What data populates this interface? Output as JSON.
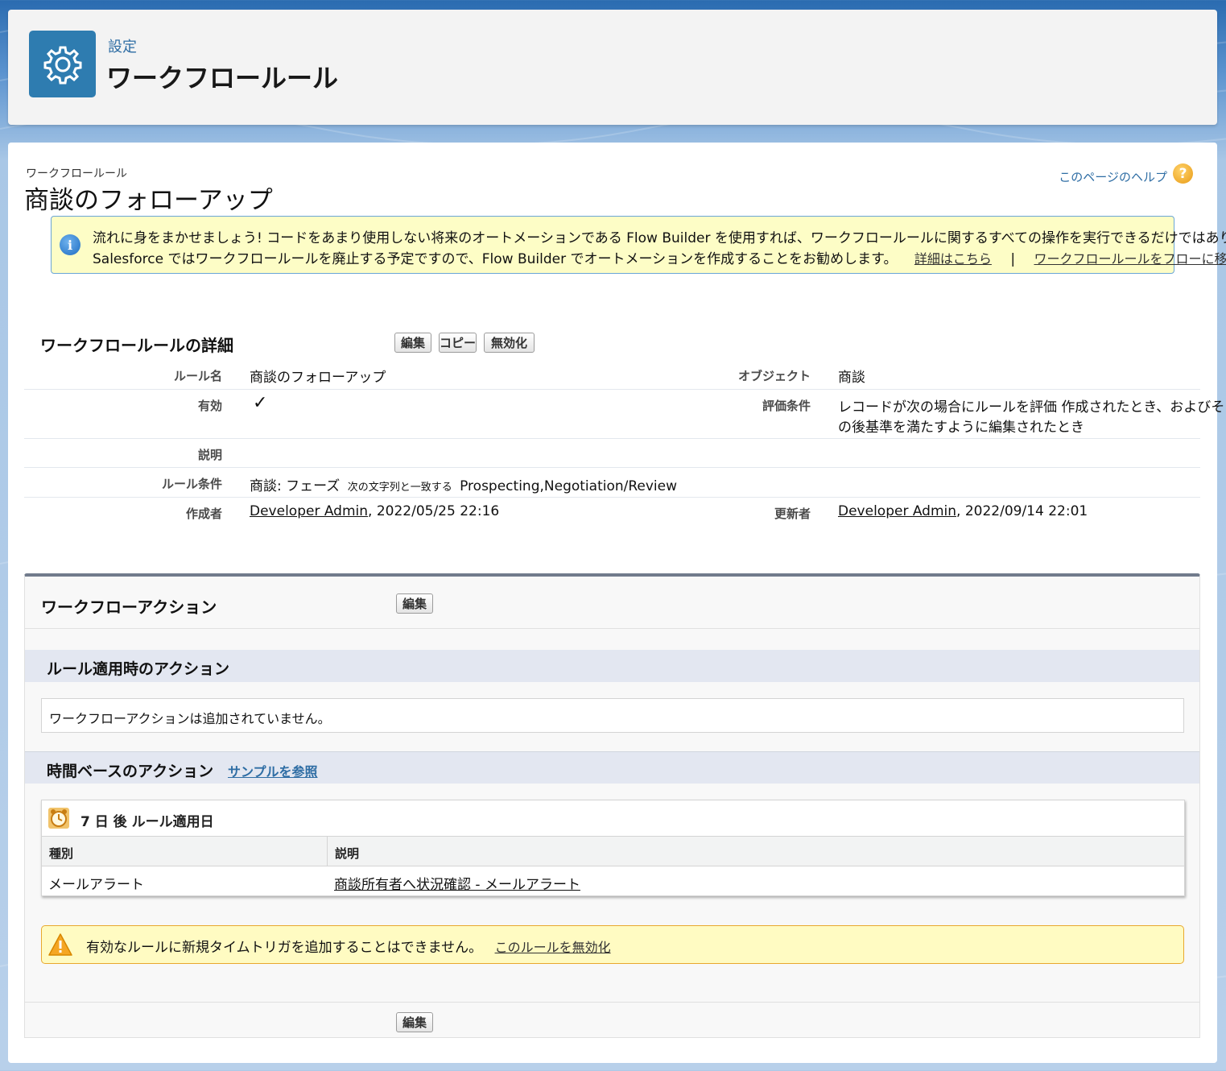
{
  "header": {
    "subtitle": "設定",
    "title": "ワークフロールール",
    "icon": "gear-icon"
  },
  "page": {
    "breadcrumb": "ワークフロールール",
    "title": "商談のフォローアップ",
    "help_link": "このページのヘルプ",
    "help_icon_glyph": "?"
  },
  "info_banner": {
    "icon_glyph": "i",
    "line1": "流れに身をまかせましょう! コードをあまり使用しない将来のオートメーションである Flow Builder を使用すれば、ワークフロールールに関するすべての操作を実行できるだけではありません!",
    "line2": "Salesforce ではワークフロールールを廃止する予定ですので、Flow Builder でオートメーションを作成することをお勧めします。",
    "link_details": "詳細はこちら",
    "separator": "|",
    "link_migrate": "ワークフロールールをフローに移行"
  },
  "detail": {
    "section_title": "ワークフロールールの詳細",
    "buttons": {
      "edit": "編集",
      "copy": "コピー",
      "deactivate": "無効化"
    },
    "rule_name_label": "ルール名",
    "rule_name": "商談のフォローアップ",
    "object_label": "オブジェクト",
    "object": "商談",
    "active_label": "有効",
    "active_check": "✓",
    "eval_label": "評価条件",
    "eval_line1": "レコードが次の場合にルールを評価 作成されたとき、およびそ",
    "eval_line2": "の後基準を満たすように編集されたとき",
    "description_label": "説明",
    "criteria_label": "ルール条件",
    "criteria_field": "商談: フェーズ",
    "criteria_op": "次の文字列と一致する",
    "criteria_value": "Prospecting,Negotiation/Review",
    "created_label": "作成者",
    "created_by": "Developer Admin",
    "created_at": ", 2022/05/25 22:16",
    "modified_label": "更新者",
    "modified_by": "Developer Admin",
    "modified_at": ", 2022/09/14 22:01"
  },
  "actions": {
    "section_title": "ワークフローアクション",
    "edit_button": "編集",
    "immediate_title": "ルール適用時のアクション",
    "immediate_empty": "ワークフローアクションは追加されていません。",
    "time_title": "時間ベースのアクション",
    "time_sample_link": "サンプルを参照",
    "trigger_title": "7 日 後 ルール適用日",
    "trigger_icon": "alarm-clock-icon",
    "table_headers": [
      "種別",
      "説明"
    ],
    "table_rows": [
      {
        "type": "メールアラート",
        "description": "商談所有者へ状況確認 - メールアラート"
      }
    ],
    "warning_text": "有効なルールに新規タイムトリガを追加することはできません。",
    "warning_link": "このルールを無効化",
    "warning_icon": "warning-icon",
    "bottom_edit_button": "編集"
  }
}
